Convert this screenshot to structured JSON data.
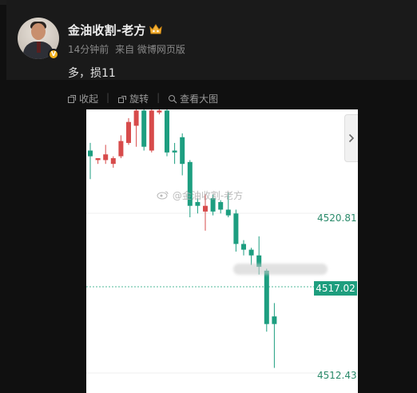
{
  "post": {
    "username": "金油收割-老方",
    "time": "14分钟前",
    "source": "来自 微博网页版",
    "text": "多，损11",
    "verified_badge": "V",
    "badge_icon": "crown-icon"
  },
  "actions": {
    "collapse": "收起",
    "rotate": "旋转",
    "view_large": "查看大图"
  },
  "chart": {
    "watermark": "@金油收割-老方",
    "up_color": "#d74b4b",
    "down_color": "#1d9e80",
    "price_labels": [
      "4520.81",
      "4517.02",
      "4512.43"
    ]
  },
  "chart_data": {
    "type": "candlestick",
    "unit": "price",
    "ylim": [
      4511.0,
      4526.4
    ],
    "current_price": 4517.02,
    "y_ticks": [
      4520.81,
      4512.43
    ],
    "candles": [
      {
        "o": 4524.1,
        "h": 4524.5,
        "l": 4522.6,
        "c": 4523.8,
        "dir": "down"
      },
      {
        "o": 4523.6,
        "h": 4523.7,
        "l": 4523.4,
        "c": 4523.7,
        "dir": "up"
      },
      {
        "o": 4523.6,
        "h": 4524.4,
        "l": 4523.4,
        "c": 4523.9,
        "dir": "up"
      },
      {
        "o": 4523.4,
        "h": 4523.8,
        "l": 4523.2,
        "c": 4523.7,
        "dir": "up"
      },
      {
        "o": 4523.8,
        "h": 4524.9,
        "l": 4523.7,
        "c": 4524.6,
        "dir": "up"
      },
      {
        "o": 4524.5,
        "h": 4525.8,
        "l": 4524.4,
        "c": 4525.6,
        "dir": "up"
      },
      {
        "o": 4525.4,
        "h": 4526.4,
        "l": 4524.3,
        "c": 4526.2,
        "dir": "up"
      },
      {
        "o": 4526.2,
        "h": 4526.4,
        "l": 4524.1,
        "c": 4524.3,
        "dir": "down"
      },
      {
        "o": 4524.1,
        "h": 4526.4,
        "l": 4524.0,
        "c": 4526.2,
        "dir": "up"
      },
      {
        "o": 4526.1,
        "h": 4526.4,
        "l": 4526.0,
        "c": 4526.2,
        "dir": "up"
      },
      {
        "o": 4526.2,
        "h": 4526.4,
        "l": 4523.8,
        "c": 4524.0,
        "dir": "down"
      },
      {
        "o": 4524.1,
        "h": 4524.5,
        "l": 4523.4,
        "c": 4524.0,
        "dir": "down"
      },
      {
        "o": 4524.8,
        "h": 4525.0,
        "l": 4522.8,
        "c": 4523.4,
        "dir": "down"
      },
      {
        "o": 4523.5,
        "h": 4523.6,
        "l": 4520.6,
        "c": 4521.2,
        "dir": "down"
      },
      {
        "o": 4521.4,
        "h": 4521.6,
        "l": 4520.8,
        "c": 4521.2,
        "dir": "down"
      },
      {
        "o": 4521.2,
        "h": 4521.8,
        "l": 4519.9,
        "c": 4520.9,
        "dir": "up"
      },
      {
        "o": 4521.6,
        "h": 4521.8,
        "l": 4520.7,
        "c": 4520.9,
        "dir": "down"
      },
      {
        "o": 4521.4,
        "h": 4521.5,
        "l": 4520.8,
        "c": 4521.0,
        "dir": "down"
      },
      {
        "o": 4521.0,
        "h": 4521.9,
        "l": 4520.6,
        "c": 4520.7,
        "dir": "down"
      },
      {
        "o": 4520.8,
        "h": 4521.0,
        "l": 4518.8,
        "c": 4519.2,
        "dir": "down"
      },
      {
        "o": 4519.2,
        "h": 4519.4,
        "l": 4518.6,
        "c": 4518.9,
        "dir": "down"
      },
      {
        "o": 4518.9,
        "h": 4519.0,
        "l": 4518.1,
        "c": 4518.6,
        "dir": "down"
      },
      {
        "o": 4518.6,
        "h": 4519.6,
        "l": 4517.6,
        "c": 4518.0,
        "dir": "down"
      },
      {
        "o": 4517.8,
        "h": 4517.9,
        "l": 4514.6,
        "c": 4515.0,
        "dir": "down"
      },
      {
        "o": 4515.4,
        "h": 4516.1,
        "l": 4512.7,
        "c": 4515.0,
        "dir": "down"
      }
    ]
  }
}
